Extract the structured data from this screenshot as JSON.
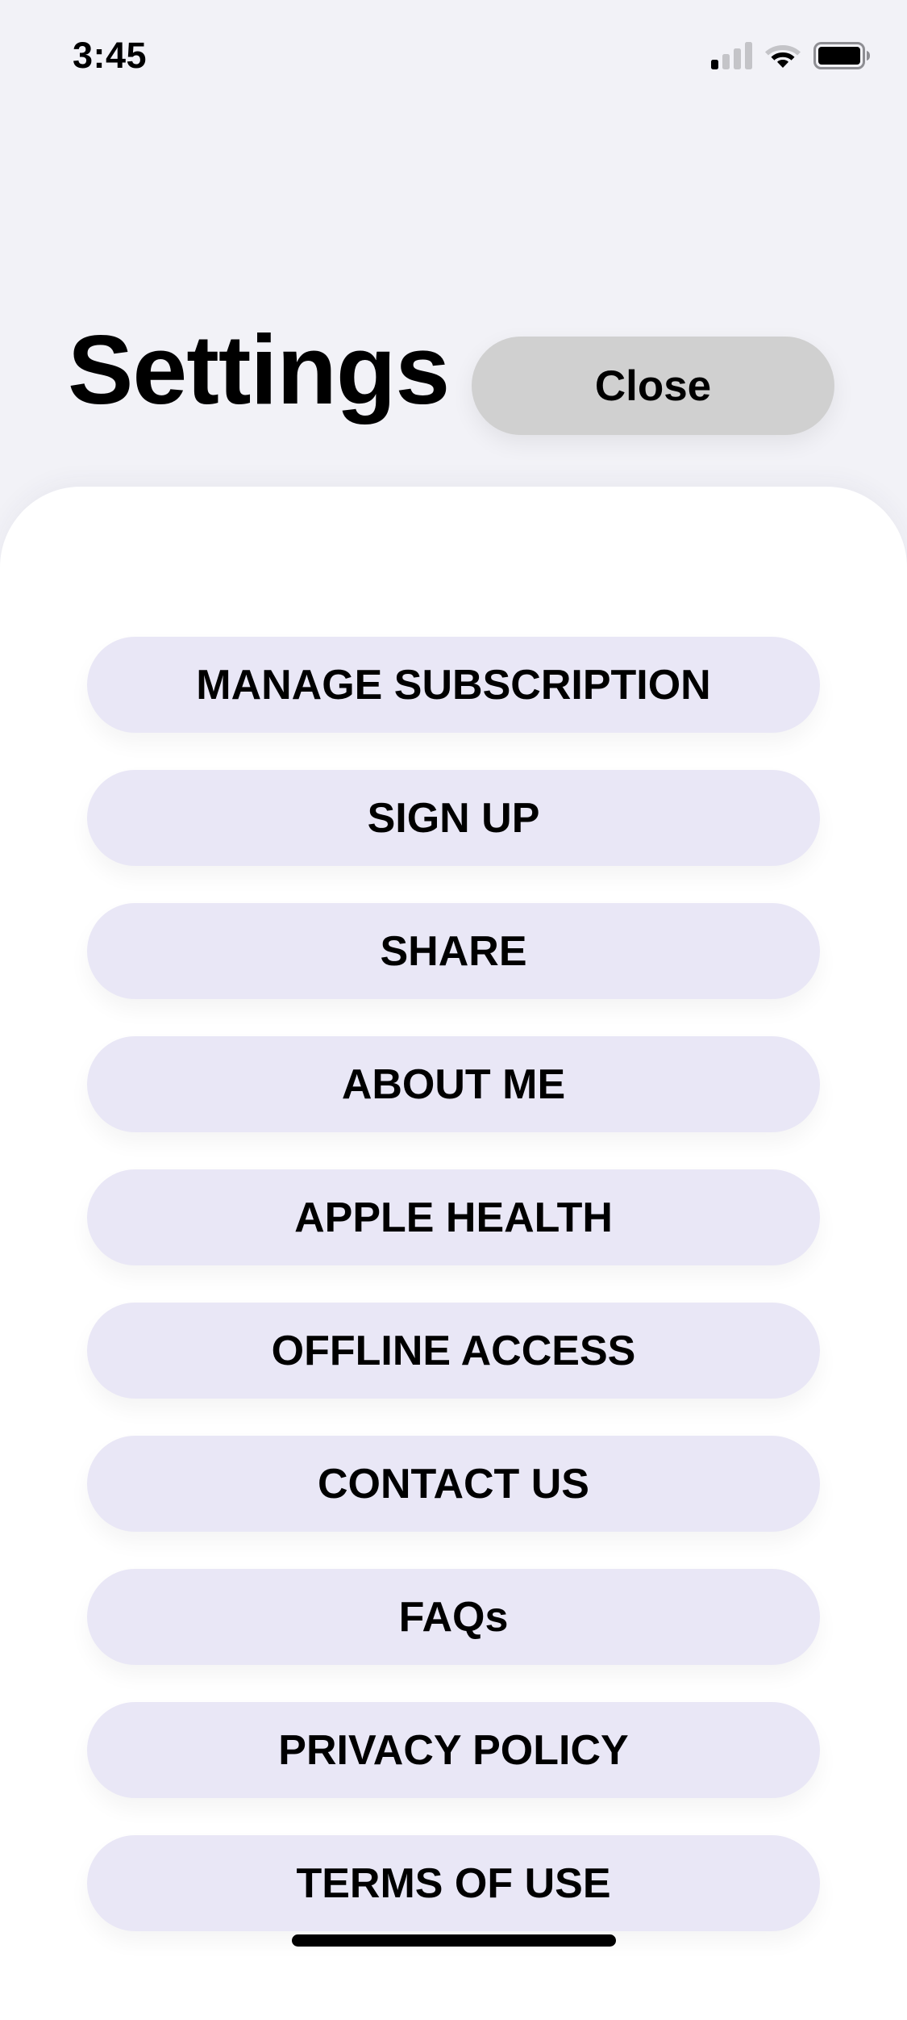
{
  "status_bar": {
    "time": "3:45",
    "icons": [
      "cellular-signal-icon",
      "wifi-icon",
      "battery-icon"
    ],
    "signal_bars_active": 1,
    "signal_bars_total": 4,
    "battery_level": 1.0
  },
  "header": {
    "title": "Settings",
    "close_label": "Close"
  },
  "menu": {
    "items": [
      {
        "label": "MANAGE SUBSCRIPTION"
      },
      {
        "label": "SIGN UP"
      },
      {
        "label": "SHARE"
      },
      {
        "label": "ABOUT ME"
      },
      {
        "label": "APPLE HEALTH"
      },
      {
        "label": "OFFLINE ACCESS"
      },
      {
        "label": "CONTACT US"
      },
      {
        "label": "FAQs"
      },
      {
        "label": "PRIVACY POLICY"
      },
      {
        "label": "TERMS OF USE"
      }
    ]
  },
  "colors": {
    "background": "#F2F2F7",
    "sheet": "#FFFFFF",
    "menu_button": "#E9E7F6",
    "close_button": "#D0D0D0",
    "text": "#000000"
  }
}
